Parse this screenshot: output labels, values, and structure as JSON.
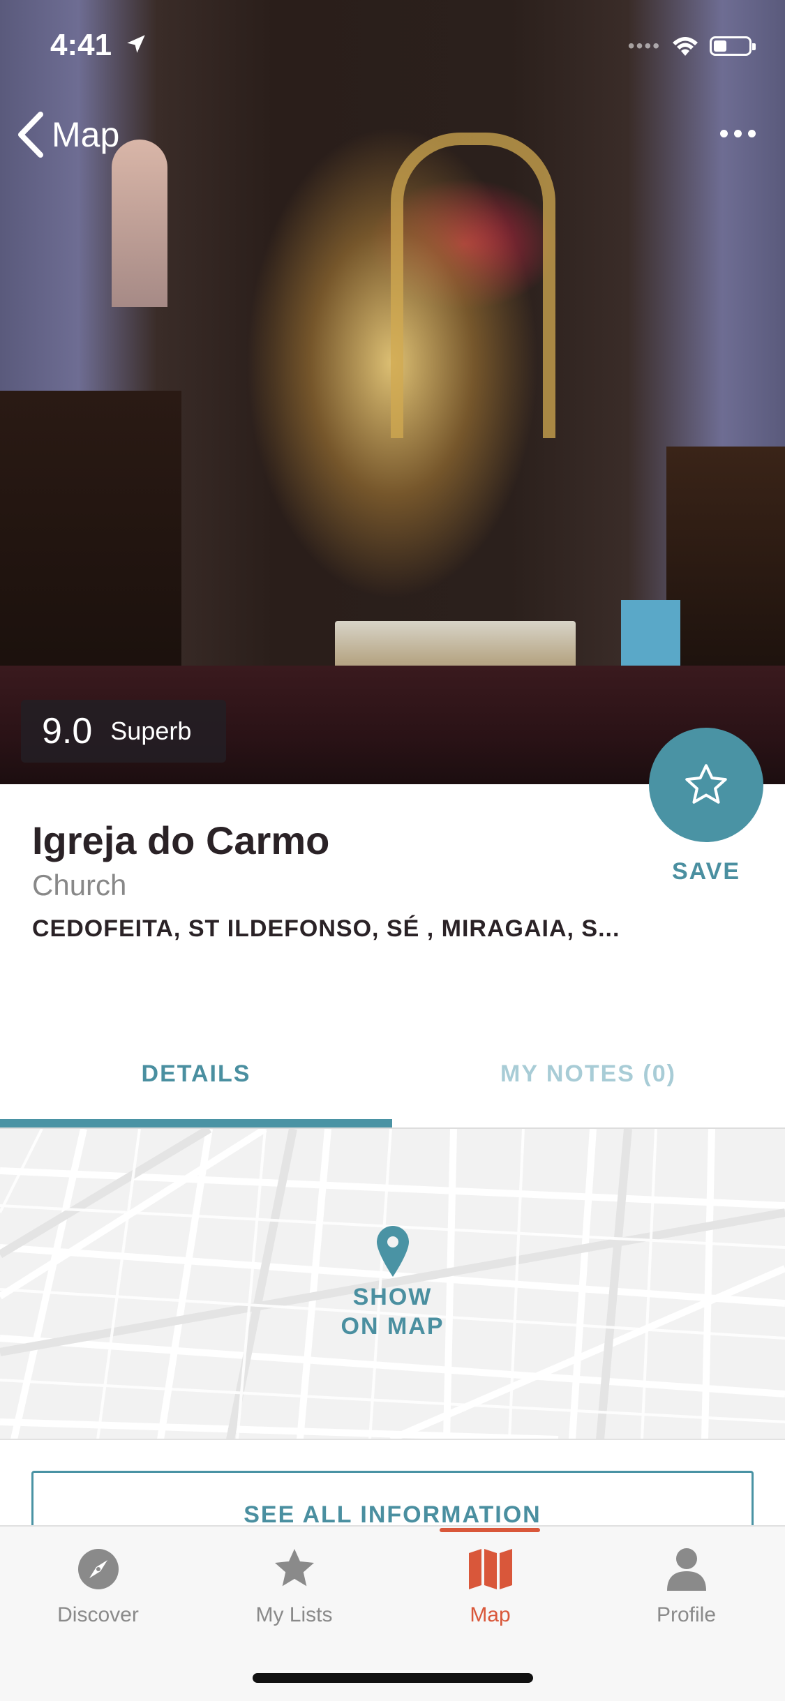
{
  "status_bar": {
    "time": "4:41"
  },
  "nav": {
    "back_label": "Map"
  },
  "hero": {
    "score": "9.0",
    "score_word": "Superb"
  },
  "place": {
    "name": "Igreja do Carmo",
    "category": "Church",
    "address": "CEDOFEITA, ST ILDEFONSO, SÉ , MIRAGAIA, S..."
  },
  "save": {
    "label": "SAVE"
  },
  "tabs": [
    {
      "label": "DETAILS",
      "active": true
    },
    {
      "label": "MY NOTES (0)",
      "active": false
    }
  ],
  "map": {
    "line1": "SHOW",
    "line2": "ON MAP"
  },
  "see_all": {
    "label": "SEE ALL INFORMATION"
  },
  "tabbar": [
    {
      "label": "Discover",
      "icon": "compass-icon"
    },
    {
      "label": "My Lists",
      "icon": "star-icon"
    },
    {
      "label": "Map",
      "icon": "map-icon",
      "active": true
    },
    {
      "label": "Profile",
      "icon": "profile-icon"
    }
  ],
  "colors": {
    "accent": "#4a93a4",
    "active_tab": "#d9573a"
  }
}
